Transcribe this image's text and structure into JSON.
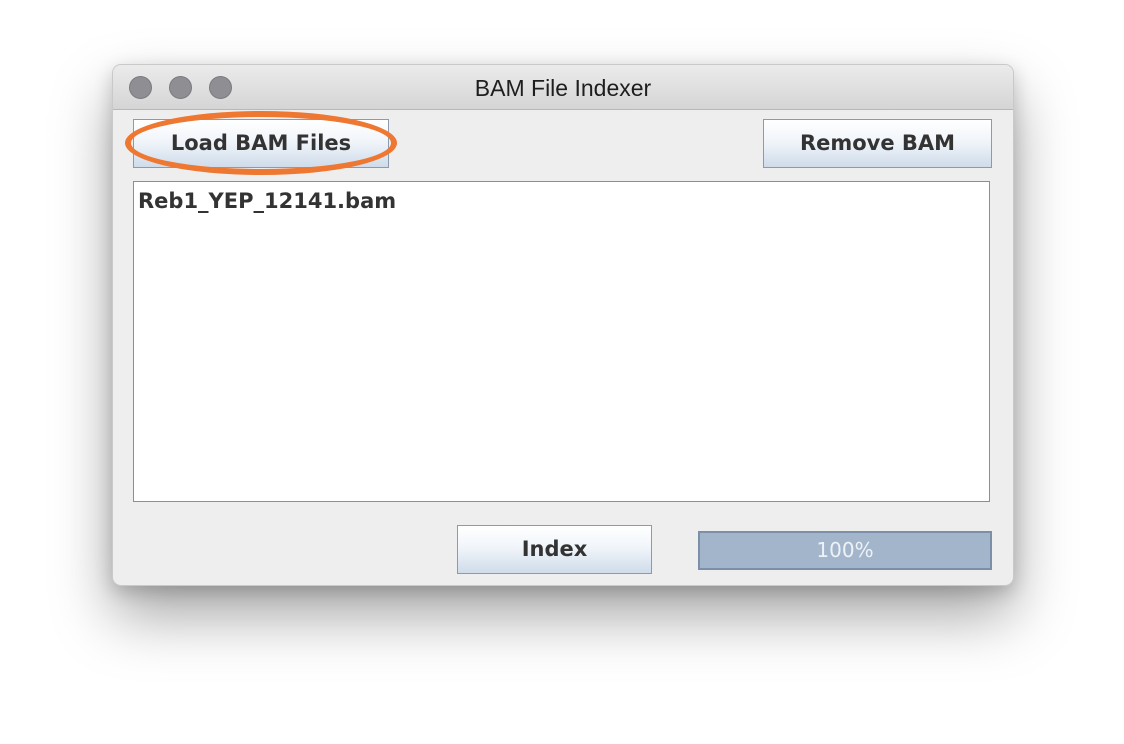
{
  "window": {
    "title": "BAM File Indexer"
  },
  "toolbar": {
    "load_label": "Load BAM Files",
    "remove_label": "Remove BAM"
  },
  "file_list": {
    "items": [
      "Reb1_YEP_12141.bam"
    ]
  },
  "footer": {
    "index_label": "Index",
    "progress_text": "100%",
    "progress_value": 1.0
  },
  "colors": {
    "highlight": "#ee7731",
    "progress": "#a3b5cb"
  }
}
